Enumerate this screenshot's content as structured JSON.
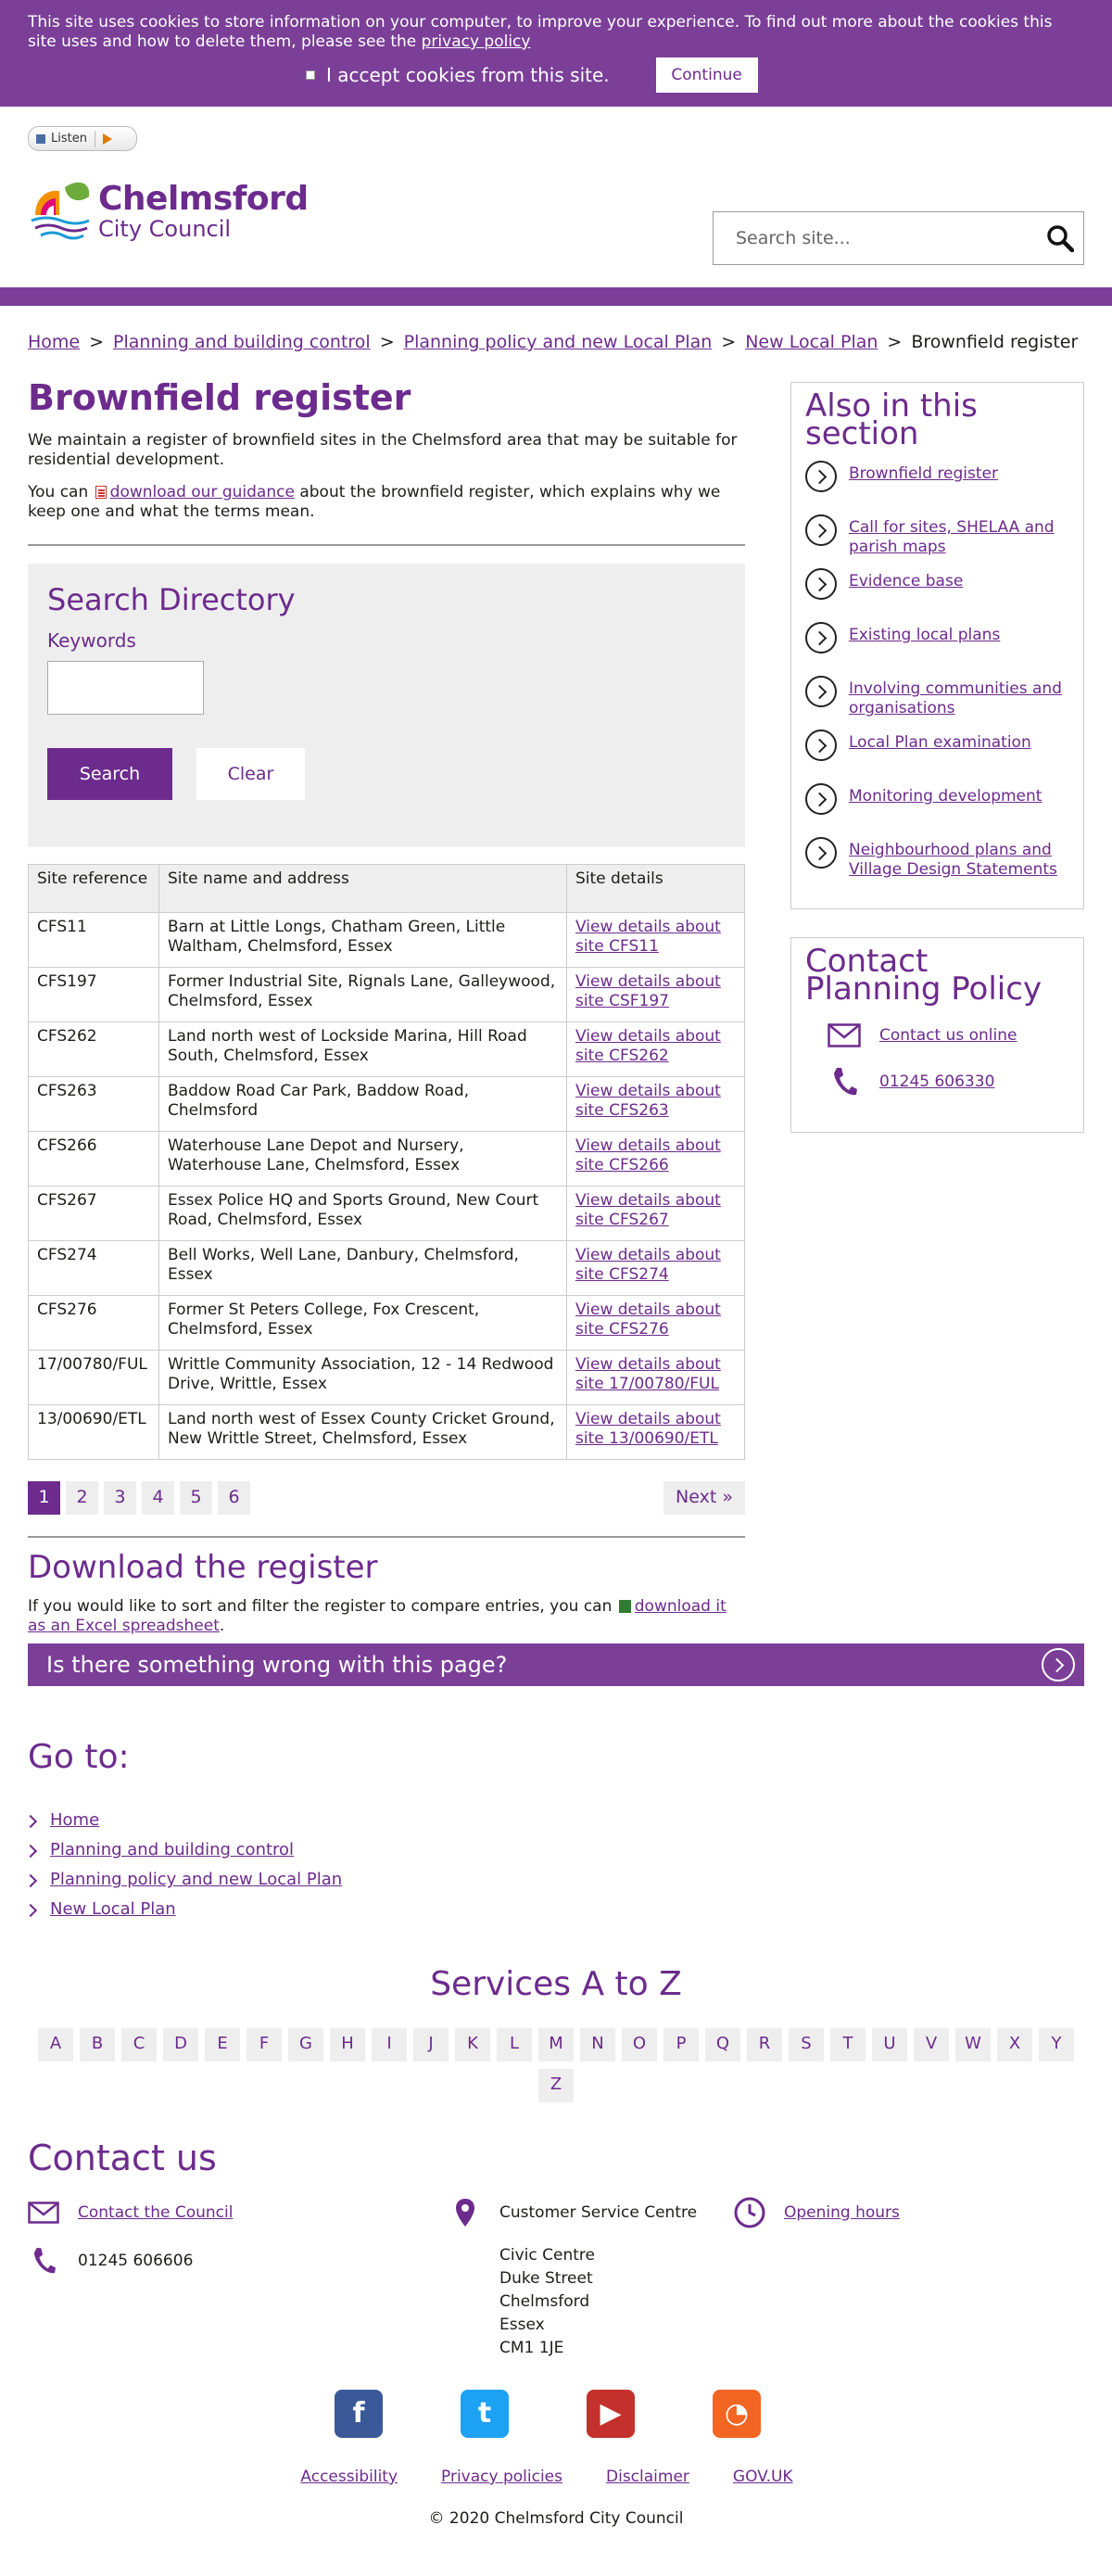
{
  "cookie": {
    "message": "This site uses cookies to store information on your computer, to improve your experience. To find out more about the cookies this site uses and how to delete them, please see the",
    "link": "privacy policy",
    "accept_label": "I accept cookies from this site.",
    "continue": "Continue"
  },
  "header": {
    "listen": "Listen",
    "logo_line1": "Chelmsford",
    "logo_line2": "City Council",
    "search_placeholder": "Search site..."
  },
  "breadcrumb": [
    "Home",
    "Planning and building control",
    "Planning policy and new Local Plan",
    "New Local Plan",
    "Brownfield register"
  ],
  "main": {
    "title": "Brownfield register",
    "intro": "We maintain a register of brownfield sites in the Chelmsford area that may be suitable for residential development.",
    "intro2_pre": "You can",
    "intro2_link": "download our guidance",
    "intro2_post": "about the brownfield register, which explains why we keep one and what the terms mean."
  },
  "search_directory": {
    "title": "Search Directory",
    "keywords_label": "Keywords",
    "search_button": "Search",
    "clear_button": "Clear"
  },
  "table": {
    "headers": [
      "Site reference",
      "Site name and address",
      "Site details"
    ],
    "rows": [
      {
        "ref": "CFS11",
        "name": "Barn at Little Longs, Chatham Green,  Little Waltham,  Chelmsford,  Essex",
        "link": "View details about site CFS11"
      },
      {
        "ref": "CFS197",
        "name": "Former Industrial Site, Rignals Lane, Galleywood,  Chelmsford,  Essex",
        "link": "View details about site CSF197"
      },
      {
        "ref": "CFS262",
        "name": "Land north west of Lockside Marina, Hill Road South, Chelmsford, Essex",
        "link": "View details about site CFS262"
      },
      {
        "ref": "CFS263",
        "name": "Baddow Road Car Park,  Baddow Road, Chelmsford",
        "link": "View details about site CFS263"
      },
      {
        "ref": "CFS266",
        "name": "Waterhouse Lane Depot and Nursery, Waterhouse Lane, Chelmsford, Essex",
        "link": "View details about site CFS266"
      },
      {
        "ref": "CFS267",
        "name": "Essex Police HQ and Sports Ground, New Court Road,  Chelmsford,  Essex",
        "link": "View details about site CFS267"
      },
      {
        "ref": "CFS274",
        "name": "Bell Works,  Well Lane,  Danbury,  Chelmsford, Essex",
        "link": "View details about site CFS274"
      },
      {
        "ref": "CFS276",
        "name": "Former St Peters College,  Fox Crescent, Chelmsford,  Essex",
        "link": "View details about site CFS276"
      },
      {
        "ref": "17/00780/FUL",
        "name": "Writtle Community Association, 12 - 14 Redwood Drive, Writtle, Essex",
        "link": "View details about site 17/00780/FUL"
      },
      {
        "ref": "13/00690/ETL",
        "name": "Land north west of Essex County Cricket Ground, New Writtle Street,  Chelmsford,  Essex",
        "link": "View details about site 13/00690/ETL"
      }
    ]
  },
  "pagination": {
    "pages": [
      "1",
      "2",
      "3",
      "4",
      "5",
      "6"
    ],
    "current": "1",
    "next": "Next »"
  },
  "download": {
    "title": "Download the register",
    "text_pre": "If you would like to sort and filter the register to compare entries, you can",
    "link": "download it as an Excel spreadsheet",
    "text_post": "."
  },
  "sidebar": {
    "title": "Also in this section",
    "items": [
      "Brownfield register",
      "Call for sites, SHELAA and parish maps",
      "Evidence base",
      "Existing local plans",
      "Involving communities and organisations",
      "Local Plan examination",
      "Monitoring development",
      "Neighbourhood plans and Village Design Statements"
    ],
    "contact_title": "Contact Planning Policy",
    "contact_online": "Contact us online",
    "contact_phone": "01245 606330"
  },
  "wrong_bar": "Is there something wrong with this page?",
  "goto": {
    "title": "Go to:",
    "items": [
      "Home",
      "Planning and building control",
      "Planning policy and new Local Plan",
      "New Local Plan"
    ]
  },
  "az": {
    "title": "Services A to Z",
    "letters": [
      "A",
      "B",
      "C",
      "D",
      "E",
      "F",
      "G",
      "H",
      "I",
      "J",
      "K",
      "L",
      "M",
      "N",
      "O",
      "P",
      "Q",
      "R",
      "S",
      "T",
      "U",
      "V",
      "W",
      "X",
      "Y",
      "Z"
    ]
  },
  "contact": {
    "title": "Contact us",
    "contact_link": "Contact the Council",
    "phone": "01245 606606",
    "centre": "Customer Service Centre",
    "address": [
      "Civic Centre",
      "Duke Street",
      "Chelmsford",
      "Essex",
      "CM1 1JE"
    ],
    "opening": "Opening hours"
  },
  "social": [
    {
      "icon": "facebook-icon",
      "glyph": "f",
      "color": "#3b5998"
    },
    {
      "icon": "twitter-icon",
      "glyph": "t",
      "color": "#1da1f2"
    },
    {
      "icon": "youtube-icon",
      "glyph": "▶",
      "color": "#c4302b"
    },
    {
      "icon": "rss-icon",
      "glyph": "◔",
      "color": "#f26522"
    }
  ],
  "footer": {
    "links": [
      "Accessibility",
      "Privacy policies",
      "Disclaimer",
      "GOV.UK"
    ],
    "copyright": "© 2020 Chelmsford City Council"
  },
  "colors": {
    "brand": "#6c2b8d",
    "banner": "#7b3f98"
  }
}
